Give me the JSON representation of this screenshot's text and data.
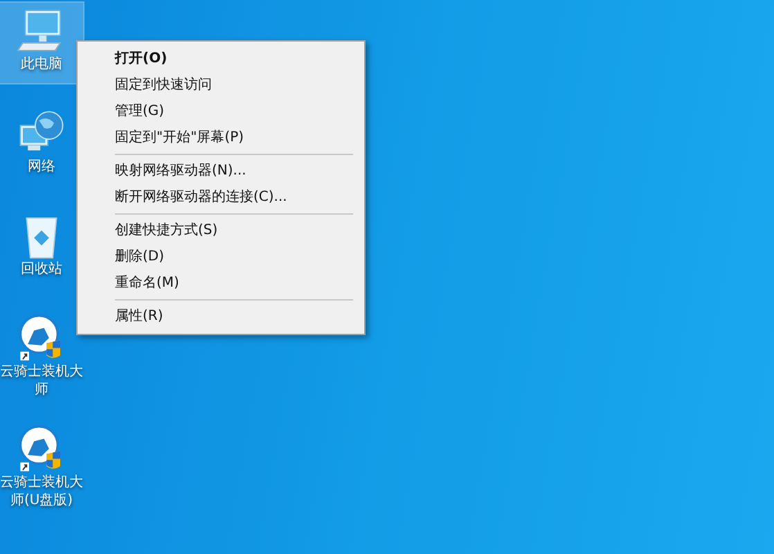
{
  "desktop_icons": [
    {
      "label": "此电脑",
      "kind": "computer",
      "selected": true
    },
    {
      "label": "网络",
      "kind": "network",
      "selected": false
    },
    {
      "label": "回收站",
      "kind": "recycle-bin",
      "selected": false
    },
    {
      "label": "云骑士装机大师",
      "kind": "app",
      "selected": false
    },
    {
      "label": "云骑士装机大师(U盘版)",
      "kind": "app",
      "selected": false
    }
  ],
  "context_menu": {
    "sections": [
      [
        {
          "label": "打开(O)",
          "default": true
        },
        {
          "label": "固定到快速访问",
          "default": false
        },
        {
          "label": "管理(G)",
          "default": false
        },
        {
          "label": "固定到\"开始\"屏幕(P)",
          "default": false
        }
      ],
      [
        {
          "label": "映射网络驱动器(N)...",
          "default": false
        },
        {
          "label": "断开网络驱动器的连接(C)...",
          "default": false
        }
      ],
      [
        {
          "label": "创建快捷方式(S)",
          "default": false
        },
        {
          "label": "删除(D)",
          "default": false
        },
        {
          "label": "重命名(M)",
          "default": false
        }
      ],
      [
        {
          "label": "属性(R)",
          "default": false
        }
      ]
    ]
  }
}
